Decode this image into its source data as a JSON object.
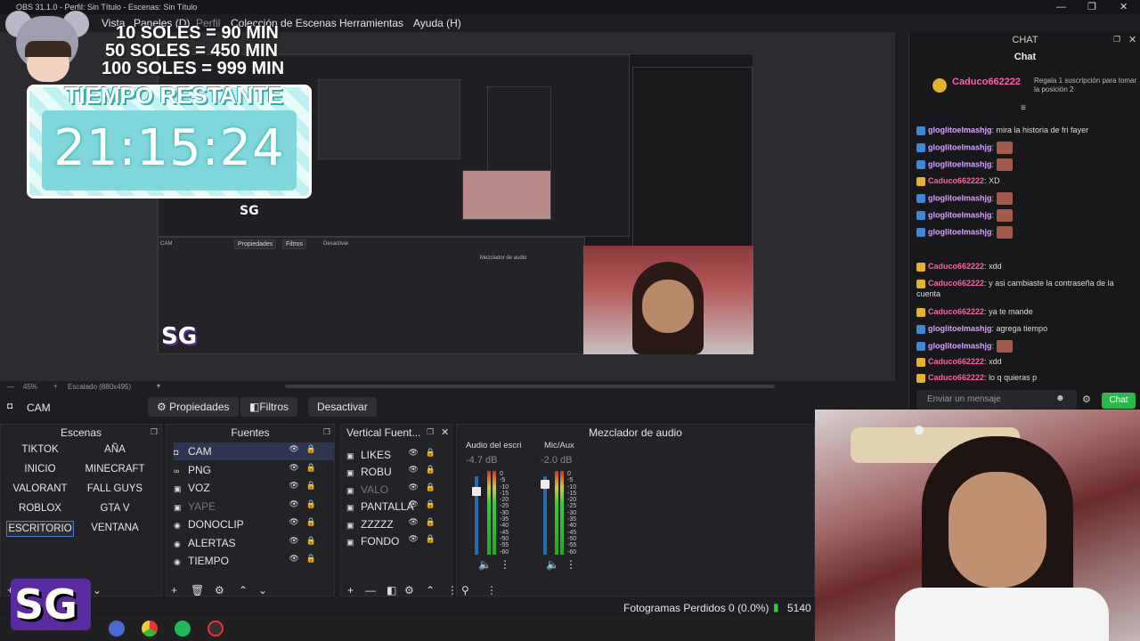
{
  "window": {
    "title": "OBS 31.1.0 - Perfil: Sin Título - Escenas: Sin Título"
  },
  "menu": [
    "Vista",
    "Paneles (D)",
    "Perfil",
    "Colección de Escenas",
    "Herramientas",
    "Ayuda (H)"
  ],
  "overlay": {
    "prices": [
      "10 SOLES = 90 MIN",
      "50 SOLES = 450 MIN",
      "100 SOLES = 999 MIN"
    ],
    "timer_label": "TIEMPO RESTANTE",
    "timer_value": "21:15:24",
    "watermark": "SG"
  },
  "chat": {
    "dock_title": "CHAT",
    "panel_title": "Chat",
    "top_user": "Caduco662222",
    "top_note": "Regala 1 suscripción para tomar la posición 2",
    "messages": [
      {
        "user": "gloglitoelmashjg",
        "text": "mira la historia de fri fayer"
      },
      {
        "user": "gloglitoelmashjg",
        "text": ""
      },
      {
        "user": "gloglitoelmashjg",
        "text": ""
      },
      {
        "user": "Caduco662222",
        "text": "XD"
      },
      {
        "user": "gloglitoelmashjg",
        "text": ""
      },
      {
        "user": "gloglitoelmashjg",
        "text": ""
      },
      {
        "user": "gloglitoelmashjg",
        "text": ""
      },
      {
        "user": "Caduco662222",
        "text": "xdd"
      },
      {
        "user": "Caduco662222",
        "text": "y asi cambiaste la contraseña de la cuenta"
      },
      {
        "user": "Caduco662222",
        "text": "ya te mande"
      },
      {
        "user": "gloglitoelmashjg",
        "text": "agrega tiempo"
      },
      {
        "user": "gloglitoelmashjg",
        "text": ""
      },
      {
        "user": "Caduco662222",
        "text": "xdd"
      },
      {
        "user": "Caduco662222",
        "text": "lo q quieras p"
      }
    ],
    "input_placeholder": "Enviar un mensaje",
    "send_label": "Chat"
  },
  "scale": {
    "zoom": "45%",
    "label": "Escalado (880x495)"
  },
  "context": {
    "source": "CAM",
    "properties": "Propiedades",
    "filters": "Filtros",
    "deactivate": "Desactivar"
  },
  "scenes": {
    "title": "Escenas",
    "items": [
      "TIKTOK",
      "AÑA",
      "INICIO",
      "MINECRAFT",
      "VALORANT",
      "FALL GUYS",
      "ROBLOX",
      "GTA V",
      "ESCRITORIO",
      "VENTANA"
    ]
  },
  "sources": {
    "title": "Fuentes",
    "items": [
      {
        "name": "CAM",
        "icon": "camera-icon"
      },
      {
        "name": "PNG",
        "icon": "link-icon"
      },
      {
        "name": "VOZ",
        "icon": "image-icon"
      },
      {
        "name": "YAPE",
        "icon": "image-icon"
      },
      {
        "name": "DONOCLIP",
        "icon": "globe-icon"
      },
      {
        "name": "ALERTAS",
        "icon": "globe-icon"
      },
      {
        "name": "TIEMPO",
        "icon": "globe-icon"
      }
    ]
  },
  "vertical": {
    "title": "Vertical Fuent...",
    "items": [
      "LIKES",
      "ROBU",
      "VALO",
      "PANTALLA",
      "ZZZZZ",
      "FONDO"
    ]
  },
  "mixer": {
    "title": "Mezclador de audio",
    "channels": [
      {
        "name": "Audio del escri",
        "db": "-4.7 dB"
      },
      {
        "name": "Mic/Aux",
        "db": "-2.0 dB"
      }
    ],
    "scale": [
      "0",
      "-5",
      "-10",
      "-15",
      "-20",
      "-25",
      "-30",
      "-35",
      "-40",
      "-45",
      "-50",
      "-55",
      "-60"
    ]
  },
  "status": {
    "dropped": "Fotogramas Perdidos 0 (0.0%)",
    "bitrate": "5140"
  }
}
